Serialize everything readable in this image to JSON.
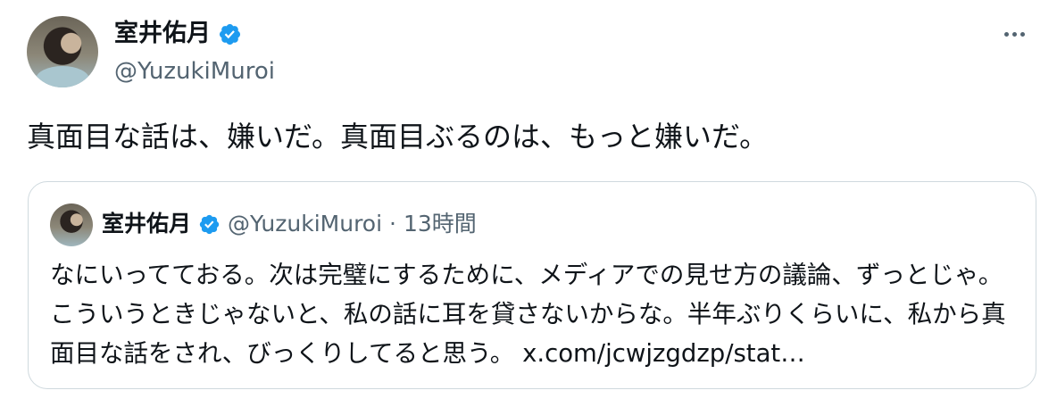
{
  "author": {
    "display_name": "室井佑月",
    "handle": "@YuzukiMuroi"
  },
  "tweet": {
    "text": "真面目な話は、嫌いだ。真面目ぶるのは、もっと嫌いだ。"
  },
  "quoted": {
    "display_name": "室井佑月",
    "handle": "@YuzukiMuroi",
    "separator": "·",
    "time": "13時間",
    "text": "なにいってておる。次は完璧にするために、メディアでの見せ方の議論、ずっとじゃ。こういうときじゃないと、私の話に耳を貸さないからな。半年ぶりくらいに、私から真面目な話をされ、びっくりしてると思う。",
    "link": "x.com/jcwjzgdzp/stat…"
  },
  "colors": {
    "verified_blue": "#1d9bf0",
    "secondary_text": "#536471",
    "border": "#cfd9de"
  },
  "icons": {
    "verified": "verified-badge-icon",
    "more": "more-options-icon"
  }
}
